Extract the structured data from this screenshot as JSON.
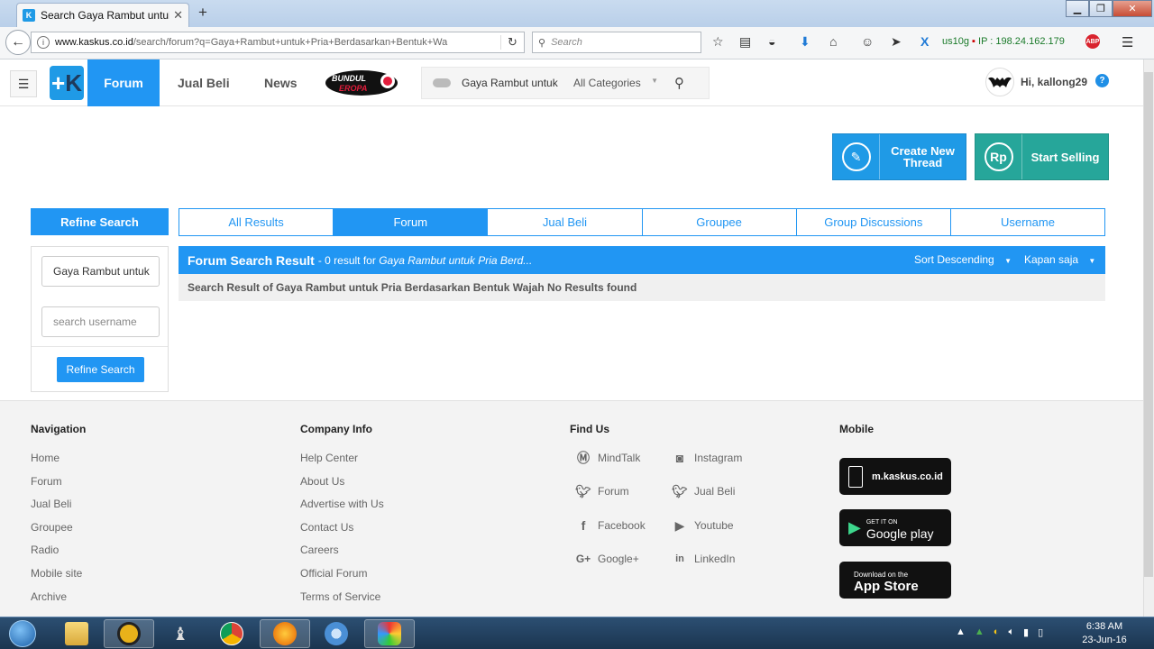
{
  "browser": {
    "tab_title": "Search Gaya Rambut untuk...",
    "tab_close": "✕",
    "new_tab": "+",
    "url_domain": "www.kaskus.co.id",
    "url_path": "/search/forum?q=Gaya+Rambut+untuk+Pria+Berdasarkan+Bentuk+Wa",
    "search_placeholder": "Search",
    "addon_user": "us10g",
    "ip_label": "IP : 198.24.162.179",
    "abp_label": "ABP"
  },
  "header": {
    "nav": [
      "Forum",
      "Jual Beli",
      "News"
    ],
    "bundul_label": "BUNDUL EROPA",
    "search_text": "Gaya Rambut untuk",
    "category": "All Categories",
    "greeting": "Hi, kallong29",
    "help": "?"
  },
  "actions": {
    "create_thread_line1": "Create New",
    "create_thread_line2": "Thread",
    "start_selling": "Start Selling",
    "rupiah": "Rp"
  },
  "refine": {
    "heading": "Refine Search",
    "query_value": "Gaya Rambut untuk",
    "username_placeholder": "search username",
    "button": "Refine Search"
  },
  "tabs": [
    "All Results",
    "Forum",
    "Jual Beli",
    "Groupee",
    "Group Discussions",
    "Username"
  ],
  "result": {
    "title": "Forum Search Result",
    "count_text": "- 0 result for",
    "query_text": "Gaya Rambut untuk Pria Berd...",
    "sort": "Sort Descending",
    "time": "Kapan saja",
    "message": "Search Result of Gaya Rambut untuk Pria Berdasarkan Bentuk Wajah No Results found"
  },
  "footer": {
    "navigation": {
      "heading": "Navigation",
      "links": [
        "Home",
        "Forum",
        "Jual Beli",
        "Groupee",
        "Radio",
        "Mobile site",
        "Archive"
      ]
    },
    "company": {
      "heading": "Company Info",
      "links": [
        "Help Center",
        "About Us",
        "Advertise with Us",
        "Contact Us",
        "Careers",
        "Official Forum",
        "Terms of Service"
      ]
    },
    "find_us": {
      "heading": "Find Us",
      "left": [
        "MindTalk",
        "Forum",
        "Facebook",
        "Google+"
      ],
      "right": [
        "Instagram",
        "Jual Beli",
        "Youtube",
        "LinkedIn"
      ]
    },
    "mobile": {
      "heading": "Mobile",
      "mkaskus": "m.kaskus.co.id",
      "gp_top": "GET IT ON",
      "gp_main": "Google play",
      "as_top": "Download on the",
      "as_main": "App Store"
    }
  },
  "taskbar": {
    "time": "6:38 AM",
    "date": "23-Jun-16"
  }
}
